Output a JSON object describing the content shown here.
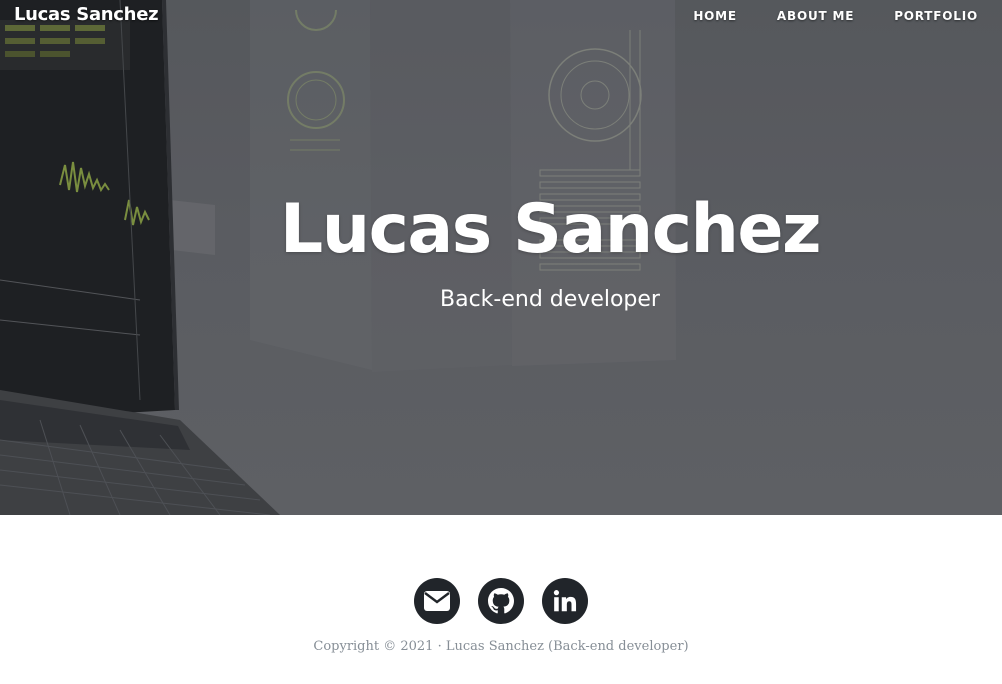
{
  "navbar": {
    "brand": "Lucas Sanchez",
    "links": [
      {
        "label": "HOME"
      },
      {
        "label": "ABOUT ME"
      },
      {
        "label": "PORTFOLIO"
      }
    ]
  },
  "hero": {
    "title": "Lucas Sanchez",
    "subtitle": "Back-end developer",
    "background": "laptop-with-dashboard-screens-photo"
  },
  "footer": {
    "social": [
      {
        "name": "email",
        "icon": "envelope-icon"
      },
      {
        "name": "github",
        "icon": "github-icon"
      },
      {
        "name": "linkedin",
        "icon": "linkedin-icon"
      }
    ],
    "copyright": "Copyright © 2021 · Lucas Sanchez (Back-end developer)"
  },
  "colors": {
    "hero_overlay": "#5a5c60",
    "social_button": "#21252a",
    "copyright_text": "#868e96",
    "accent_green": "#a7c64a"
  }
}
